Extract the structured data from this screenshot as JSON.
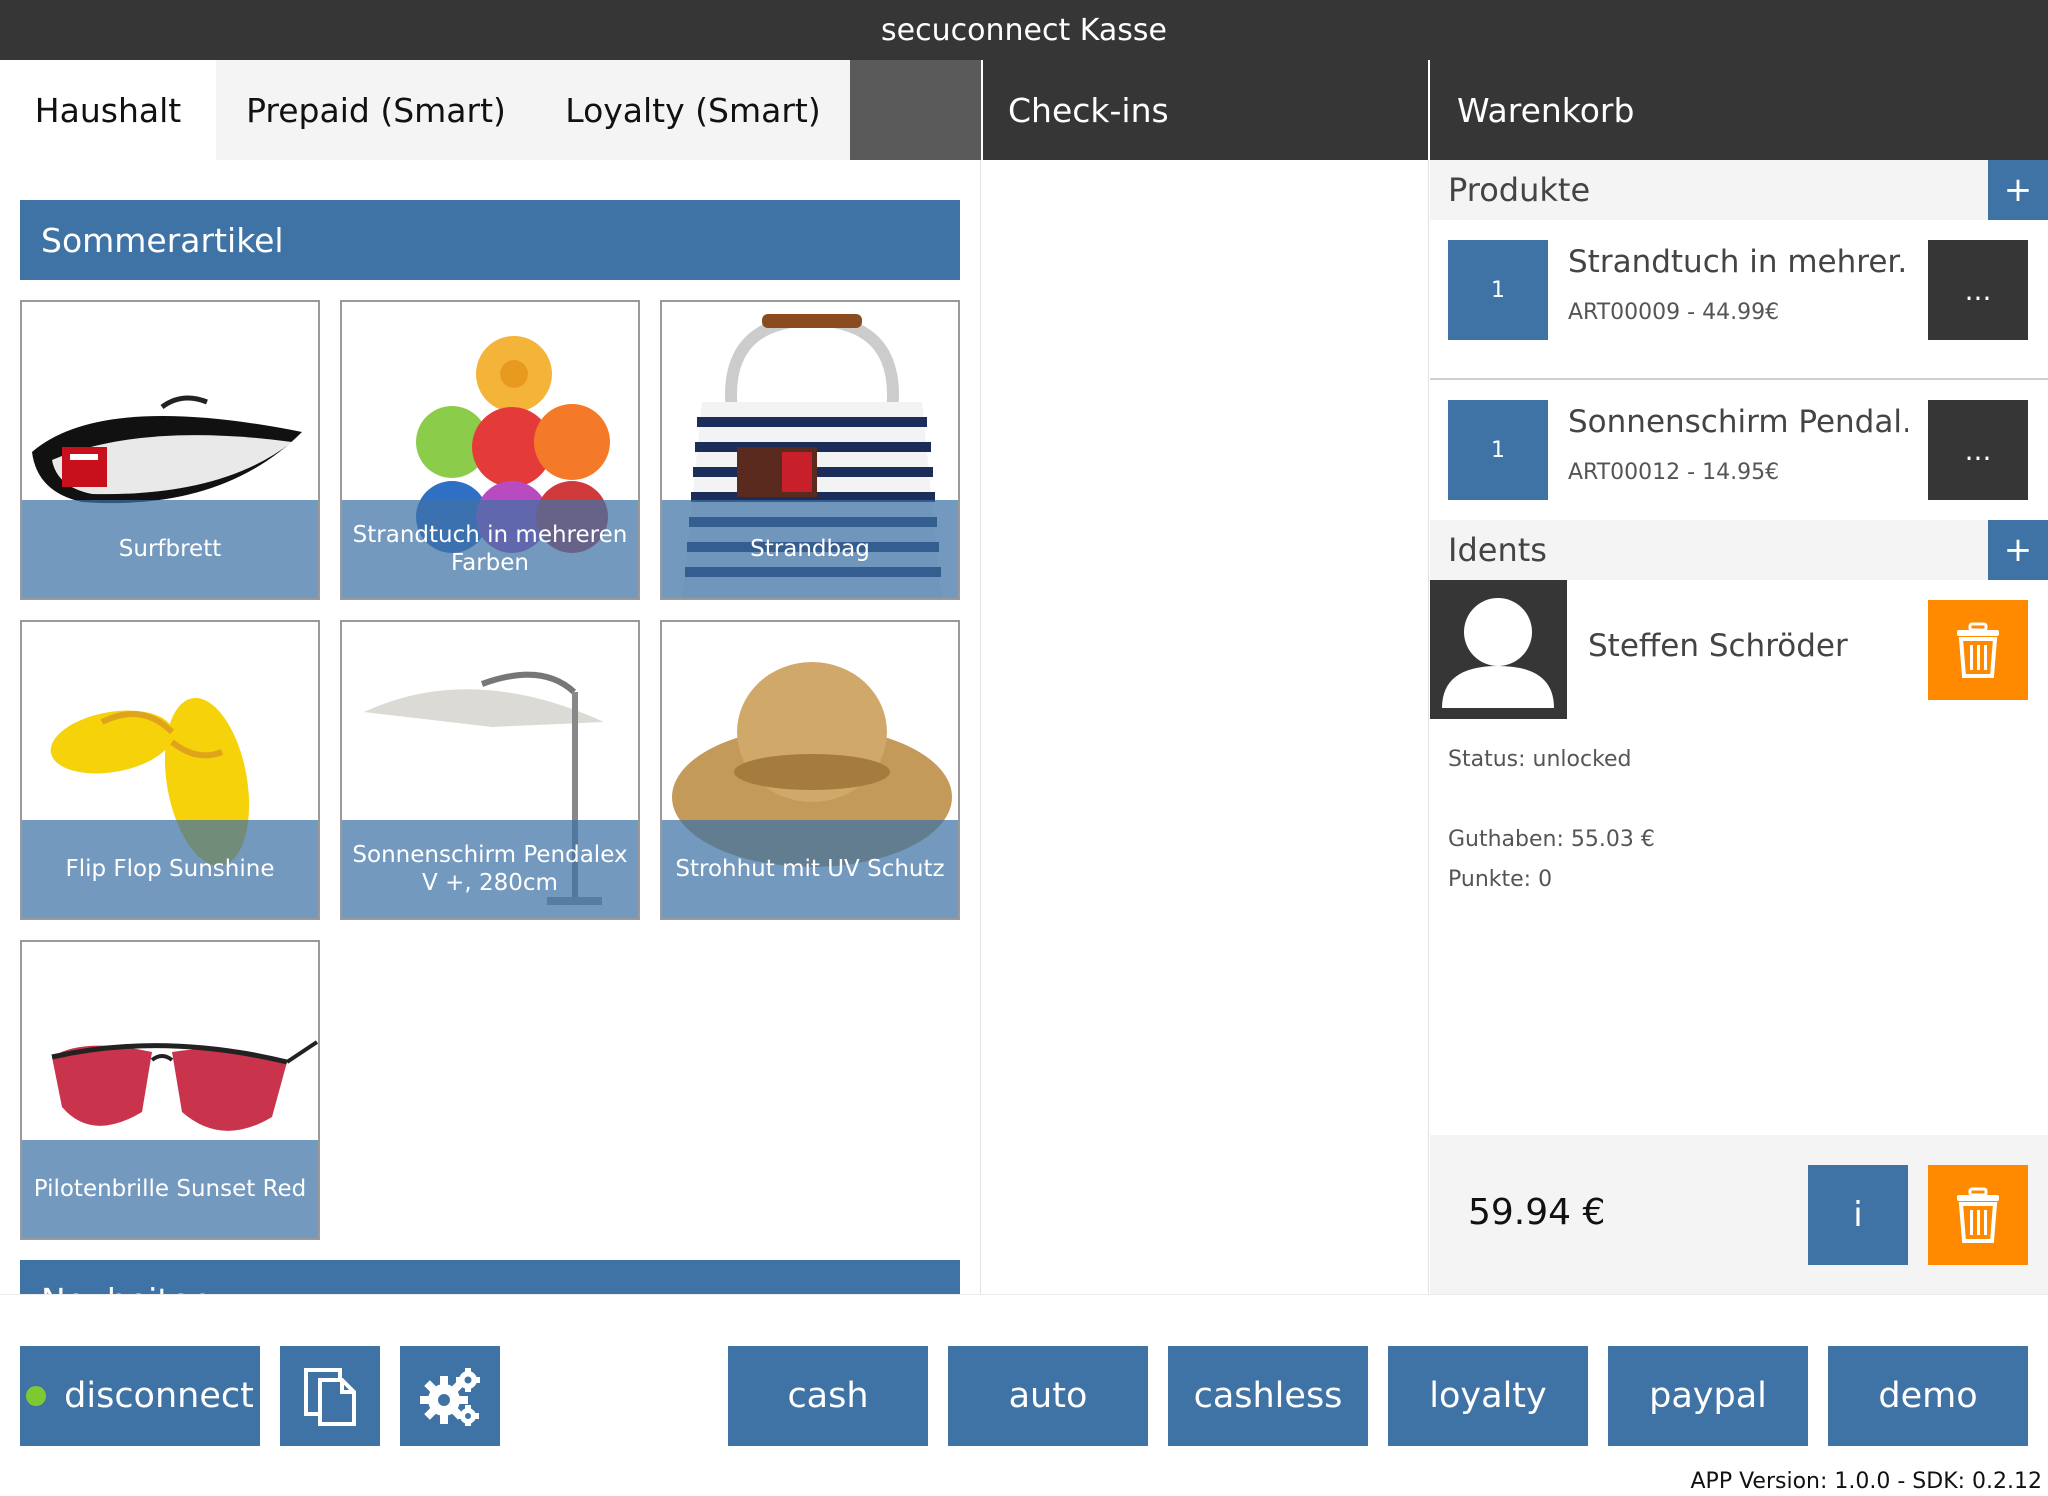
{
  "app": {
    "title": "secuconnect Kasse"
  },
  "tabs": [
    {
      "label": "Haushalt",
      "active": true
    },
    {
      "label": "Prepaid (Smart)",
      "active": false
    },
    {
      "label": "Loyalty (Smart)",
      "active": false
    }
  ],
  "checkins": {
    "title": "Check-ins"
  },
  "catalog": {
    "category": "Sommerartikel",
    "next_category": "Neuheiten",
    "products": [
      {
        "label": "Surfbrett",
        "icon": "surfboard-image"
      },
      {
        "label": "Strandtuch in mehreren Farben",
        "icon": "towels-image"
      },
      {
        "label": "Strandbag",
        "icon": "beach-bag-image"
      },
      {
        "label": "Flip Flop Sunshine",
        "icon": "flip-flops-image"
      },
      {
        "label": "Sonnenschirm Pendalex V +, 280cm",
        "icon": "parasol-image"
      },
      {
        "label": "Strohhut mit UV Schutz",
        "icon": "straw-hat-image"
      },
      {
        "label": "Pilotenbrille Sunset Red",
        "icon": "sunglasses-image"
      }
    ]
  },
  "cart": {
    "title": "Warenkorb",
    "products_label": "Produkte",
    "add_symbol": "+",
    "items": [
      {
        "qty": "1",
        "name": "Strandtuch in mehrer...",
        "sub": "ART00009 - 44.99€",
        "more": "..."
      },
      {
        "qty": "1",
        "name": "Sonnenschirm Pendal...",
        "sub": "ART00012 - 14.95€",
        "more": "..."
      }
    ],
    "idents_label": "Idents",
    "ident": {
      "name": "Steffen Schröder",
      "status": "Status: unlocked",
      "balance": "Guthaben: 55.03 €",
      "points": "Punkte: 0"
    },
    "total": "59.94 €",
    "info_label": "i"
  },
  "bottom": {
    "connection_label": "disconnect",
    "connection_status_color": "#7ec832",
    "payments": [
      "cash",
      "auto",
      "cashless",
      "loyalty",
      "paypal",
      "demo"
    ],
    "version": "APP Version: 1.0.0 - SDK: 0.2.12"
  },
  "colors": {
    "accent": "#3f72a5",
    "dark": "#363636",
    "danger": "#ff8a00"
  }
}
